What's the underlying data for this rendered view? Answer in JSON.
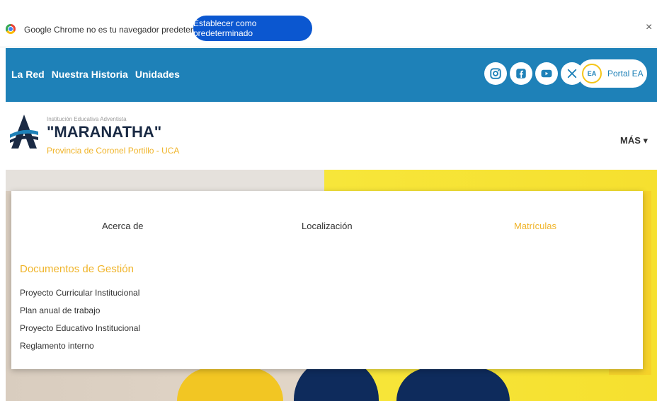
{
  "infobar": {
    "message": "Google Chrome no es tu navegador predeterminado",
    "button_label": "Establecer como predeterminado",
    "close_label": "×"
  },
  "topnav": {
    "links": [
      "La Red",
      "Nuestra Historia",
      "Unidades"
    ],
    "social_icons": [
      "instagram-icon",
      "facebook-icon",
      "youtube-icon",
      "x-icon"
    ],
    "portal": {
      "logo_text": "EA",
      "label": "Portal EA"
    },
    "color": "#1e81b8"
  },
  "header": {
    "institution_small": "Institución Educativa Adventista",
    "institution_name": "\"MARANATHA\"",
    "institution_sub": "Provincia de Coronel Portillo - UCA",
    "more_menu": "MÁS ▾"
  },
  "menu": {
    "tabs": [
      "Acerca de",
      "Localización",
      "Matrículas"
    ],
    "active_tab": "Matrículas",
    "section_title": "Documentos de Gestión",
    "documents": [
      "Proyecto Curricular Institucional",
      "Plan anual de trabajo",
      "Proyecto Educativo Institucional",
      "Reglamento interno"
    ],
    "accent_color": "#f0b429"
  }
}
